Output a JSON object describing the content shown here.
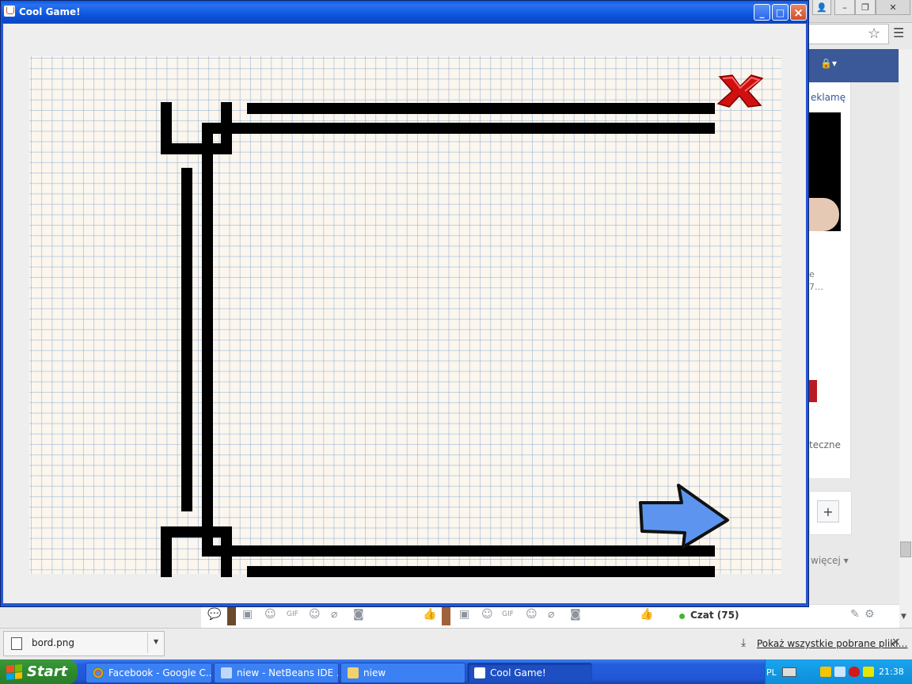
{
  "window": {
    "title": "Cool Game!",
    "buttons": {
      "minimize": "_",
      "maximize": "□",
      "close": "×"
    }
  },
  "game": {
    "close_icon": "red-x-icon",
    "next_icon": "blue-arrow-icon",
    "colors": {
      "close": "#d01010",
      "arrow": "#5c94f0",
      "paper": "#fbf6ee",
      "grid": "#a4bfe0"
    }
  },
  "browser": {
    "facebook": {
      "ad_label": "eklamę",
      "ad_line1": "e",
      "ad_line2": "7…",
      "ad_line3": "teczne",
      "more_label": "więcej ▾",
      "plus_label": "+"
    },
    "chat": {
      "label": "Czat (75)"
    }
  },
  "download_bar": {
    "file_name": "bord.png",
    "show_all": "Pokaż wszystkie pobrane pliki…",
    "close": "×"
  },
  "taskbar": {
    "start_label": "Start",
    "tasks": [
      {
        "label": "Facebook - Google C...",
        "icon_color": "#e8b020"
      },
      {
        "label": "niew - NetBeans IDE ...",
        "icon_color": "#c0d8f8"
      },
      {
        "label": "niew",
        "icon_color": "#f1d36b"
      },
      {
        "label": "Cool Game!",
        "icon_color": "#ffffff"
      }
    ],
    "tray": {
      "language": "PL",
      "clock": "21:38"
    }
  }
}
